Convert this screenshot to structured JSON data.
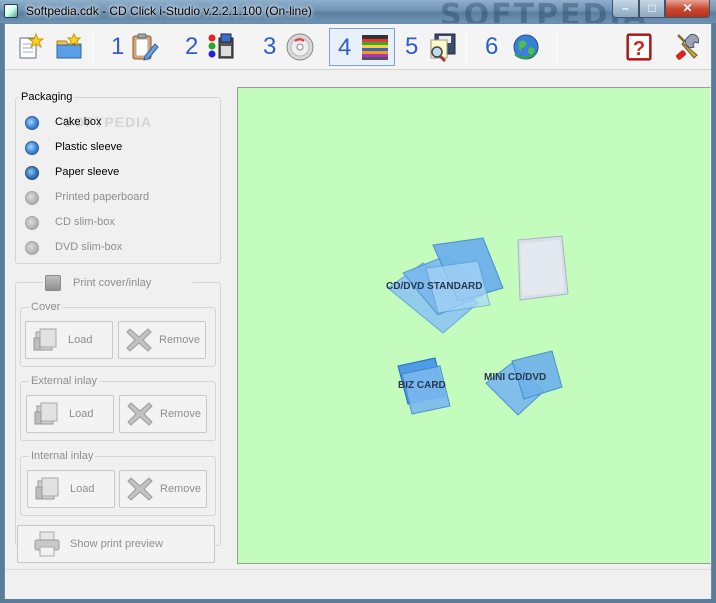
{
  "window": {
    "title": "Softpedia.cdk - CD Click i-Studio v.2.2.1.100 (On-line)",
    "watermark": "SOFTPEDIA",
    "min_glyph": "–",
    "max_glyph": "□",
    "close_glyph": "✕"
  },
  "toolbar": {
    "steps": [
      {
        "num": "1",
        "icon": "clipboard-edit-icon"
      },
      {
        "num": "2",
        "icon": "paint-palette-icon"
      },
      {
        "num": "3",
        "icon": "cd-disc-icon"
      },
      {
        "num": "4",
        "icon": "disc-cases-stack-icon",
        "selected": true
      },
      {
        "num": "5",
        "icon": "disk-search-icon"
      },
      {
        "num": "6",
        "icon": "globe-icon"
      }
    ]
  },
  "packaging": {
    "title": "Packaging",
    "watermark": "SOFTPEDIA",
    "options": [
      {
        "label": "Cake box",
        "enabled": true,
        "selected": true
      },
      {
        "label": "Plastic sleeve",
        "enabled": true,
        "selected": false
      },
      {
        "label": "Paper sleeve",
        "enabled": true,
        "selected": false
      },
      {
        "label": "Printed paperboard",
        "enabled": false,
        "selected": false
      },
      {
        "label": "CD slim-box",
        "enabled": false,
        "selected": false
      },
      {
        "label": "DVD slim-box",
        "enabled": false,
        "selected": false
      }
    ]
  },
  "print": {
    "checkbox_label": "Print cover/inlay",
    "sections": [
      {
        "title": "Cover",
        "load": "Load",
        "remove": "Remove"
      },
      {
        "title": "External inlay",
        "load": "Load",
        "remove": "Remove"
      },
      {
        "title": "Internal inlay",
        "load": "Load",
        "remove": "Remove"
      }
    ],
    "preview_label": "Show print preview"
  },
  "canvas": {
    "background": "#c4fcbe",
    "items": [
      {
        "label": "CD/DVD STANDARD"
      },
      {
        "label": "BIZ CARD"
      },
      {
        "label": "MINI CD/DVD"
      }
    ]
  }
}
